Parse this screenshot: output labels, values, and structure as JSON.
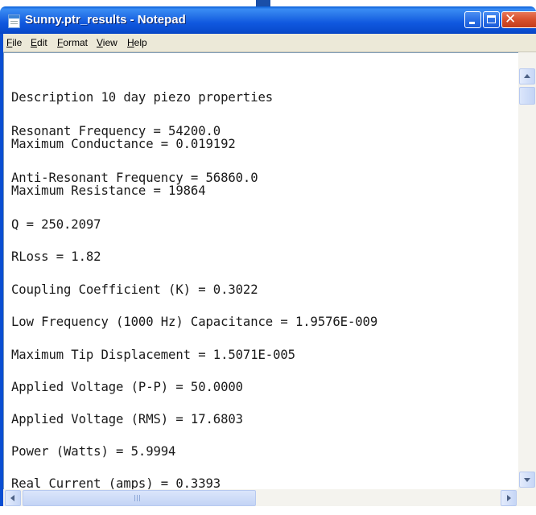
{
  "window": {
    "title": "Sunny.ptr_results - Notepad",
    "icon": "notepad-icon",
    "controls": {
      "minimize": "minimize-icon",
      "maximize": "maximize-icon",
      "close": "close-icon",
      "close_glyph": "✕"
    }
  },
  "menu": {
    "items": [
      {
        "label": "File"
      },
      {
        "label": "Edit"
      },
      {
        "label": "Format"
      },
      {
        "label": "View"
      },
      {
        "label": "Help"
      }
    ]
  },
  "document": {
    "lines": [
      "Description 10 day piezo properties",
      "Resonant Frequency = 54200.0",
      "Maximum Conductance = 0.019192",
      "Anti-Resonant Frequency = 56860.0",
      "Maximum Resistance = 19864",
      "Q = 250.2097",
      "RLoss = 1.82",
      "Coupling Coefficient (K) = 0.3022",
      "Low Frequency (1000 Hz) Capacitance = 1.9576E-009",
      "Maximum Tip Displacement = 1.5071E-005",
      "Applied Voltage (P-P) = 50.0000",
      "Applied Voltage (RMS) = 17.6803",
      "Power (Watts) = 5.9994",
      "Real Current (amps) = 0.3393"
    ]
  },
  "scrollbars": {
    "vertical_position": 0.0,
    "horizontal_position": 0.0
  },
  "colors": {
    "titlebar": "#0a4ed2",
    "menubar": "#ece9d8",
    "close_button": "#d8502c",
    "text": "#1a1a1a"
  }
}
